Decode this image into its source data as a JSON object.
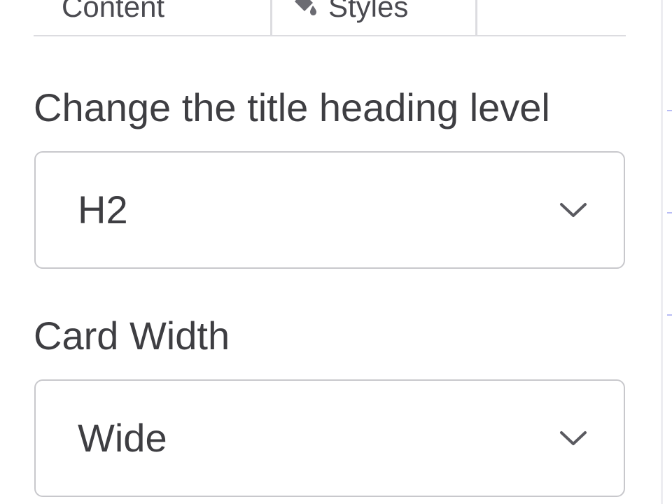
{
  "tabs": {
    "content_label": "Content",
    "styles_label": "Styles",
    "styles_icon": "paint-bucket-icon"
  },
  "heading_level": {
    "label": "Change the title heading level",
    "value": "H2",
    "icon": "chevron-down-icon"
  },
  "card_width": {
    "label": "Card Width",
    "value": "Wide",
    "icon": "chevron-down-icon"
  },
  "colors": {
    "text": "#3e3e42",
    "border": "#c8c8cc",
    "accent_edge": "#b9bdf5"
  }
}
